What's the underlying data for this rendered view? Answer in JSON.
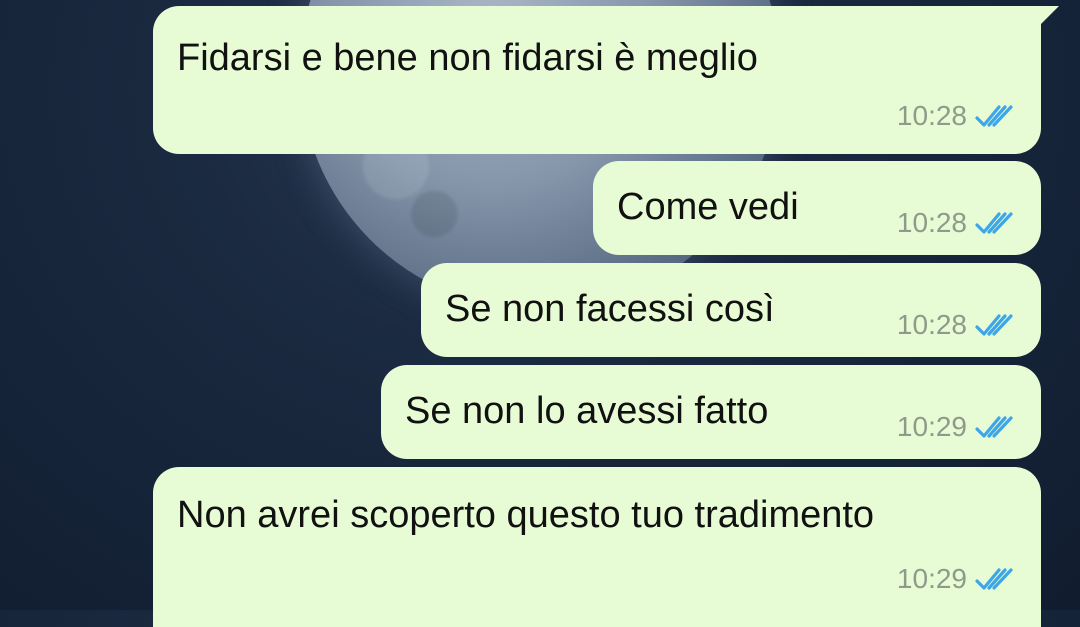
{
  "conversation": {
    "messages": [
      {
        "text": "Fidarsi e bene non fidarsi è meglio",
        "time": "10:28",
        "status_icon": "double-check-icon"
      },
      {
        "text": "Come vedi",
        "time": "10:28",
        "status_icon": "double-check-icon"
      },
      {
        "text": "Se non facessi così",
        "time": "10:28",
        "status_icon": "double-check-icon"
      },
      {
        "text": "Se non lo avessi fatto",
        "time": "10:29",
        "status_icon": "double-check-icon"
      },
      {
        "text": "Non avrei scoperto questo tuo tradimento",
        "time": "10:29",
        "status_icon": "double-check-icon"
      }
    ]
  },
  "colors": {
    "bubble_outgoing": "#e7fcd5",
    "read_check": "#3da6e8",
    "timestamp": "#8f9a8a",
    "background": "#152338"
  },
  "wallpaper": {
    "icon": "moon-wallpaper"
  }
}
